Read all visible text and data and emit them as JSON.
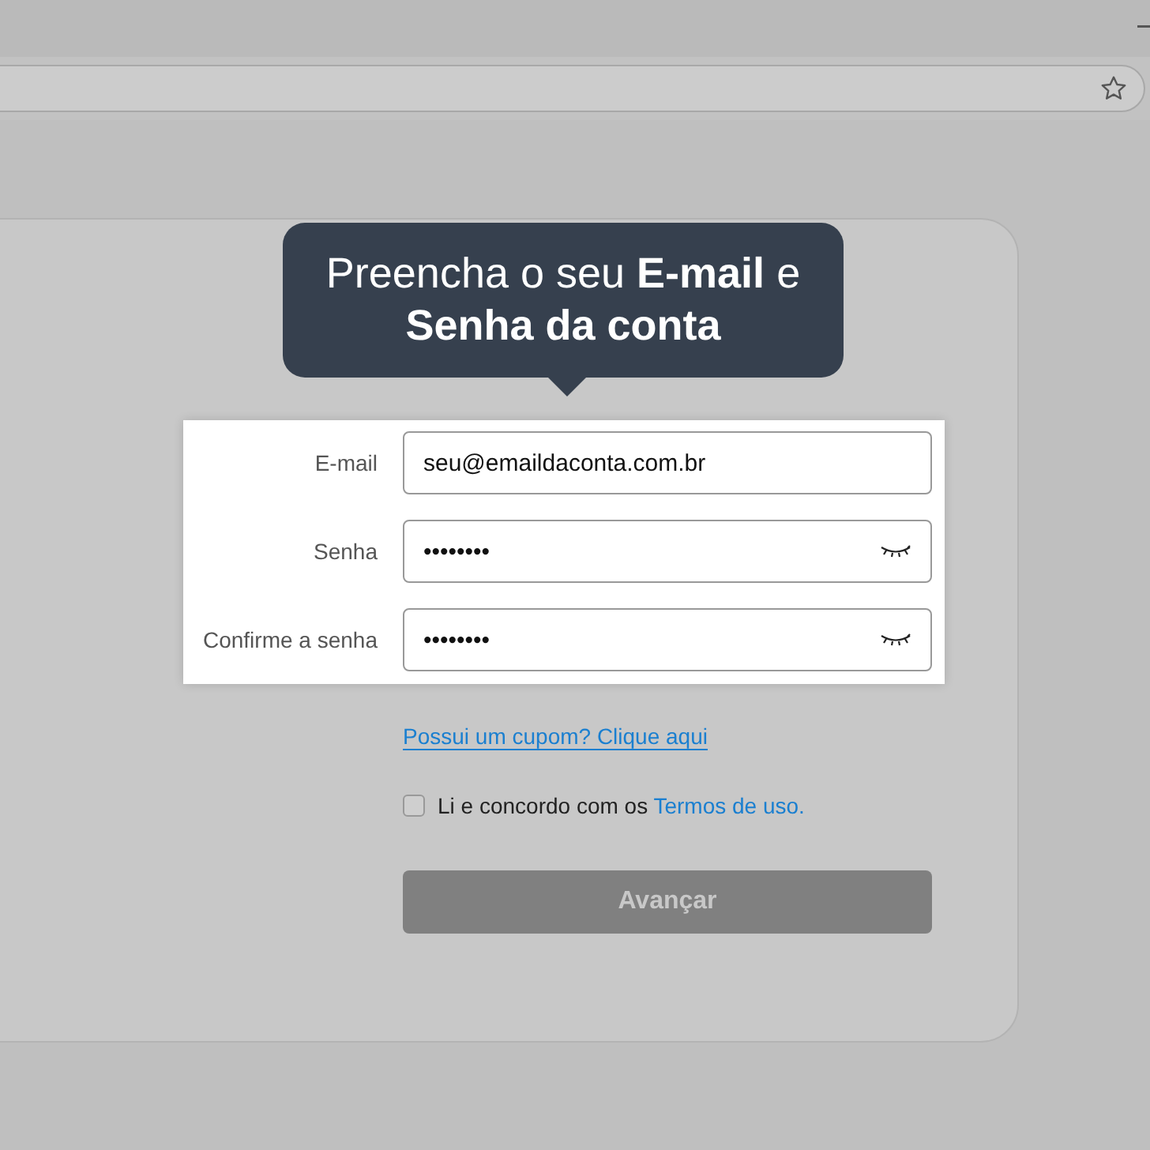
{
  "tooltip": {
    "text": "Preencha o seu **E-mail** e **Senha da conta**"
  },
  "fields": [
    {
      "label": "E-mail",
      "kind": "text",
      "value": "seu@emaildaconta.com.br"
    },
    {
      "label": "Senha",
      "kind": "password",
      "value": "••••••••"
    },
    {
      "label": "Confirme a senha",
      "kind": "password",
      "value": "••••••••"
    }
  ],
  "coupon_link": "Possui um cupom? Clique aqui",
  "terms": {
    "checked": false,
    "text": "Li e concordo com os",
    "link": "Termos de uso."
  },
  "submit": {
    "label": "Avançar",
    "disabled": true
  }
}
